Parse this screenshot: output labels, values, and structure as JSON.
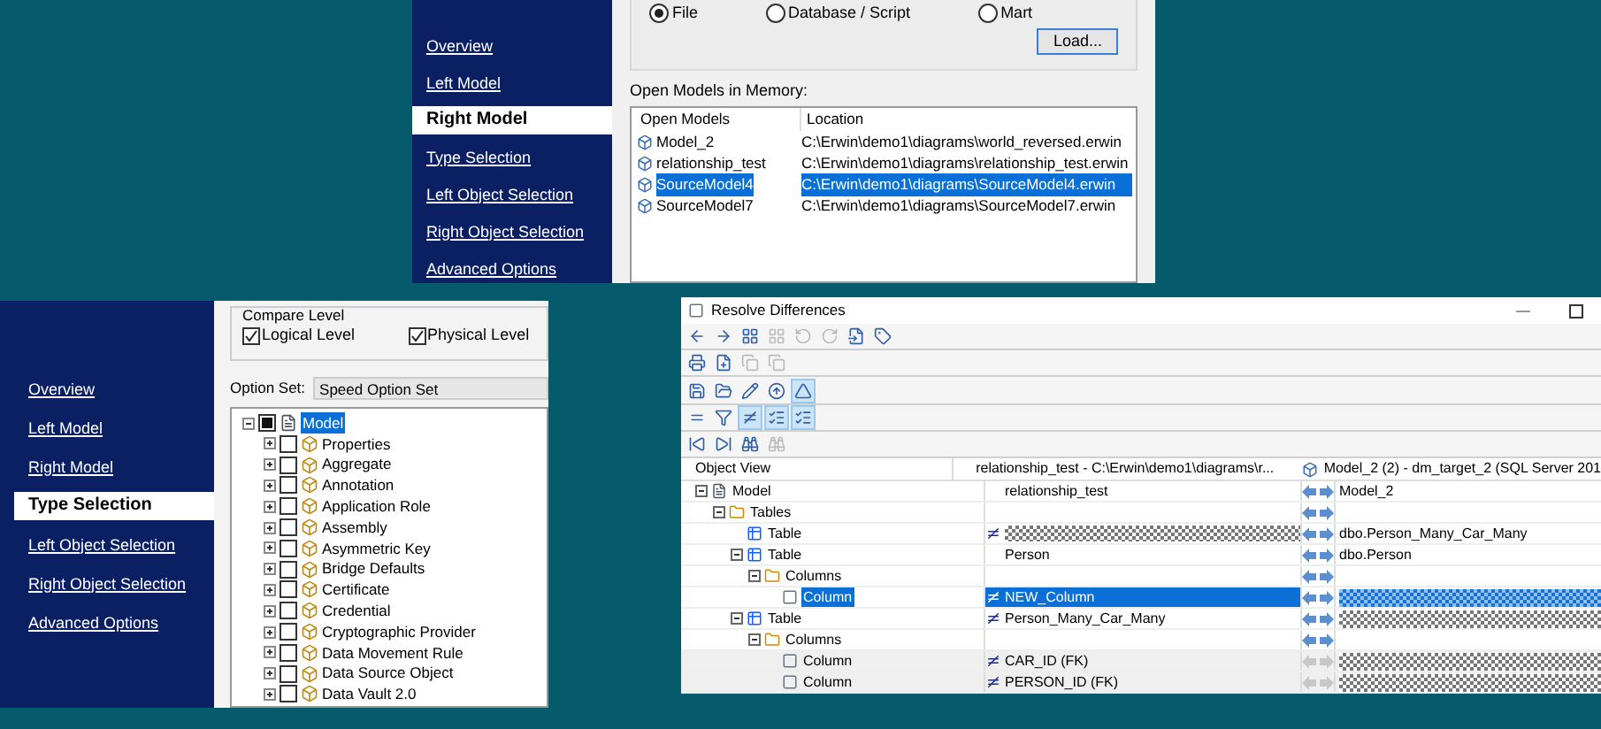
{
  "model_source_panel": {
    "nav": [
      {
        "label": "Overview",
        "selected": false
      },
      {
        "label": "Left Model",
        "selected": false
      },
      {
        "label": "Right Model",
        "selected": true
      },
      {
        "label": "Type Selection",
        "selected": false
      },
      {
        "label": "Left Object Selection",
        "selected": false
      },
      {
        "label": "Right Object Selection",
        "selected": false
      },
      {
        "label": "Advanced Options",
        "selected": false
      }
    ],
    "source_options": [
      {
        "label": "File",
        "selected": true
      },
      {
        "label": "Database / Script",
        "selected": false
      },
      {
        "label": "Mart",
        "selected": false
      }
    ],
    "load_button": "Load...",
    "open_models_label": "Open Models in Memory:",
    "columns": [
      "Open Models",
      "Location"
    ],
    "rows": [
      {
        "name": "Model_2",
        "location": "C:\\Erwin\\demo1\\diagrams\\world_reversed.erwin",
        "selected": false
      },
      {
        "name": "relationship_test",
        "location": "C:\\Erwin\\demo1\\diagrams\\relationship_test.erwin",
        "selected": false
      },
      {
        "name": "SourceModel4",
        "location": "C:\\Erwin\\demo1\\diagrams\\SourceModel4.erwin",
        "selected": true
      },
      {
        "name": "SourceModel7",
        "location": "C:\\Erwin\\demo1\\diagrams\\SourceModel7.erwin",
        "selected": false
      }
    ]
  },
  "type_selection_panel": {
    "nav": [
      {
        "label": "Overview",
        "selected": false
      },
      {
        "label": "Left Model",
        "selected": false
      },
      {
        "label": "Right Model",
        "selected": false
      },
      {
        "label": "Type Selection",
        "selected": true
      },
      {
        "label": "Left Object Selection",
        "selected": false
      },
      {
        "label": "Right Object Selection",
        "selected": false
      },
      {
        "label": "Advanced Options",
        "selected": false
      }
    ],
    "compare_level": {
      "title": "Compare Level",
      "options": [
        {
          "label": "Logical Level",
          "checked": true
        },
        {
          "label": "Physical Level",
          "checked": true
        }
      ]
    },
    "option_set": {
      "label": "Option Set:",
      "value": "Speed Option Set"
    },
    "tree_root": {
      "label": "Model",
      "selected": true,
      "expanded": true,
      "partially_checked": true
    },
    "tree_items": [
      {
        "label": "Properties",
        "checked": false
      },
      {
        "label": "Aggregate",
        "checked": false
      },
      {
        "label": "Annotation",
        "checked": false
      },
      {
        "label": "Application Role",
        "checked": false
      },
      {
        "label": "Assembly",
        "checked": false
      },
      {
        "label": "Asymmetric Key",
        "checked": false
      },
      {
        "label": "Bridge Defaults",
        "checked": false
      },
      {
        "label": "Certificate",
        "checked": false
      },
      {
        "label": "Credential",
        "checked": false
      },
      {
        "label": "Cryptographic Provider",
        "checked": false
      },
      {
        "label": "Data Movement Rule",
        "checked": false
      },
      {
        "label": "Data Source Object",
        "checked": false
      },
      {
        "label": "Data Vault 2.0",
        "checked": false
      }
    ]
  },
  "resolve_window": {
    "title": "Resolve Differences",
    "toolbars": [
      [
        {
          "kind": "back",
          "pressed": false,
          "disabled": false
        },
        {
          "kind": "forward",
          "pressed": false,
          "disabled": false
        },
        {
          "kind": "grid",
          "pressed": false,
          "disabled": false
        },
        {
          "kind": "grid",
          "pressed": false,
          "disabled": true
        },
        {
          "kind": "undo",
          "pressed": false,
          "disabled": true
        },
        {
          "kind": "redo",
          "pressed": false,
          "disabled": true
        },
        {
          "kind": "import",
          "pressed": false,
          "disabled": false
        },
        {
          "kind": "tag",
          "pressed": false,
          "disabled": false
        }
      ],
      [
        {
          "kind": "print",
          "pressed": false,
          "disabled": false
        },
        {
          "kind": "add",
          "pressed": false,
          "disabled": false
        },
        {
          "kind": "copy",
          "pressed": false,
          "disabled": true
        },
        {
          "kind": "copy",
          "pressed": false,
          "disabled": true
        }
      ],
      [
        {
          "kind": "save",
          "pressed": false,
          "disabled": false
        },
        {
          "kind": "open",
          "pressed": false,
          "disabled": false
        },
        {
          "kind": "edit",
          "pressed": false,
          "disabled": false
        },
        {
          "kind": "up",
          "pressed": false,
          "disabled": false
        },
        {
          "kind": "triangle",
          "pressed": true,
          "disabled": false
        }
      ],
      [
        {
          "kind": "equal",
          "pressed": false,
          "disabled": false
        },
        {
          "kind": "filter",
          "pressed": false,
          "disabled": false
        },
        {
          "kind": "unequal",
          "pressed": true,
          "disabled": false
        },
        {
          "kind": "list",
          "pressed": true,
          "disabled": false
        },
        {
          "kind": "list",
          "pressed": true,
          "disabled": false
        }
      ],
      [
        {
          "kind": "first",
          "pressed": false,
          "disabled": false
        },
        {
          "kind": "last",
          "pressed": false,
          "disabled": false
        },
        {
          "kind": "find",
          "pressed": false,
          "disabled": false
        },
        {
          "kind": "find",
          "pressed": false,
          "disabled": true
        }
      ]
    ],
    "columns": [
      "Object View",
      "relationship_test - C:\\Erwin\\demo1\\diagrams\\r...",
      "Model_2 (2) - dm_target_2 (SQL Server 201"
    ],
    "rows": [
      {
        "kind": "model",
        "label": "Model",
        "left": "relationship_test",
        "right": "Model_2",
        "different": false,
        "left_missing": false,
        "right_missing": false,
        "selected": false,
        "arrows_enabled": true,
        "children": [
          {
            "kind": "folder",
            "label": "Tables",
            "different": false,
            "left_missing": false,
            "right_missing": false,
            "selected": false,
            "arrows_enabled": true,
            "children": [
              {
                "kind": "table",
                "label": "Table",
                "right": "dbo.Person_Many_Car_Many",
                "different": true,
                "left_missing": true,
                "right_missing": false,
                "selected": false,
                "arrows_enabled": true
              },
              {
                "kind": "table",
                "label": "Table",
                "left": "Person",
                "right": "dbo.Person",
                "different": false,
                "left_missing": false,
                "right_missing": false,
                "selected": false,
                "arrows_enabled": true,
                "children": [
                  {
                    "kind": "folder",
                    "label": "Columns",
                    "different": false,
                    "left_missing": false,
                    "right_missing": false,
                    "selected": false,
                    "arrows_enabled": true,
                    "children": [
                      {
                        "kind": "column",
                        "label": "Column",
                        "left": "NEW_Column",
                        "different": true,
                        "left_missing": false,
                        "right_missing": true,
                        "selected": true,
                        "arrows_enabled": true
                      }
                    ]
                  }
                ]
              },
              {
                "kind": "table",
                "label": "Table",
                "left": "Person_Many_Car_Many",
                "different": true,
                "left_missing": false,
                "right_missing": true,
                "selected": false,
                "arrows_enabled": true,
                "children": [
                  {
                    "kind": "folder",
                    "label": "Columns",
                    "different": false,
                    "left_missing": false,
                    "right_missing": false,
                    "selected": false,
                    "arrows_enabled": true,
                    "children": [
                      {
                        "kind": "column",
                        "label": "Column",
                        "left": "CAR_ID (FK)",
                        "different": true,
                        "left_missing": false,
                        "right_missing": true,
                        "selected": false,
                        "arrows_enabled": false
                      },
                      {
                        "kind": "column",
                        "label": "Column",
                        "left": "PERSON_ID (FK)",
                        "different": true,
                        "left_missing": false,
                        "right_missing": true,
                        "selected": false,
                        "arrows_enabled": false
                      }
                    ]
                  }
                ]
              }
            ]
          }
        ]
      }
    ]
  }
}
